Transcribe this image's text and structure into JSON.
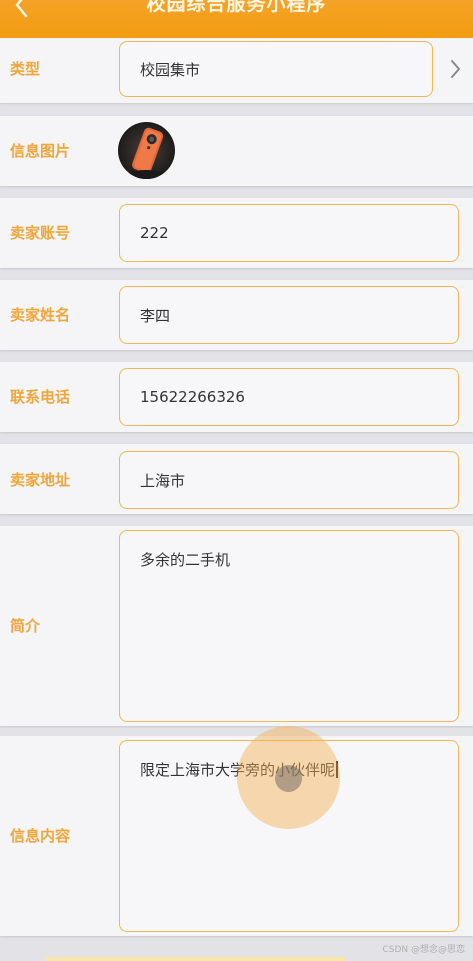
{
  "app": {
    "title": "校园综合服务小程序"
  },
  "form": {
    "type": {
      "label": "类型",
      "value": "校园集市"
    },
    "image": {
      "label": "信息图片"
    },
    "seller_account": {
      "label": "卖家账号",
      "value": "222"
    },
    "seller_name": {
      "label": "卖家姓名",
      "value": "李四"
    },
    "phone": {
      "label": "联系电话",
      "value": "15622266326"
    },
    "address": {
      "label": "卖家地址",
      "value": "上海市"
    },
    "intro": {
      "label": "简介",
      "value": "多余的二手机"
    },
    "content": {
      "label": "信息内容",
      "value": "限定上海市大学旁的小伙伴呢"
    }
  },
  "watermark": "CSDN @想念@思恋",
  "icons": {
    "back": "chevron-left-icon",
    "select": "chevron-right-icon"
  },
  "colors": {
    "accent": "#f39c12",
    "label": "#f0a63a",
    "field_border": "#f1b757",
    "background": "#e3e2e6"
  }
}
